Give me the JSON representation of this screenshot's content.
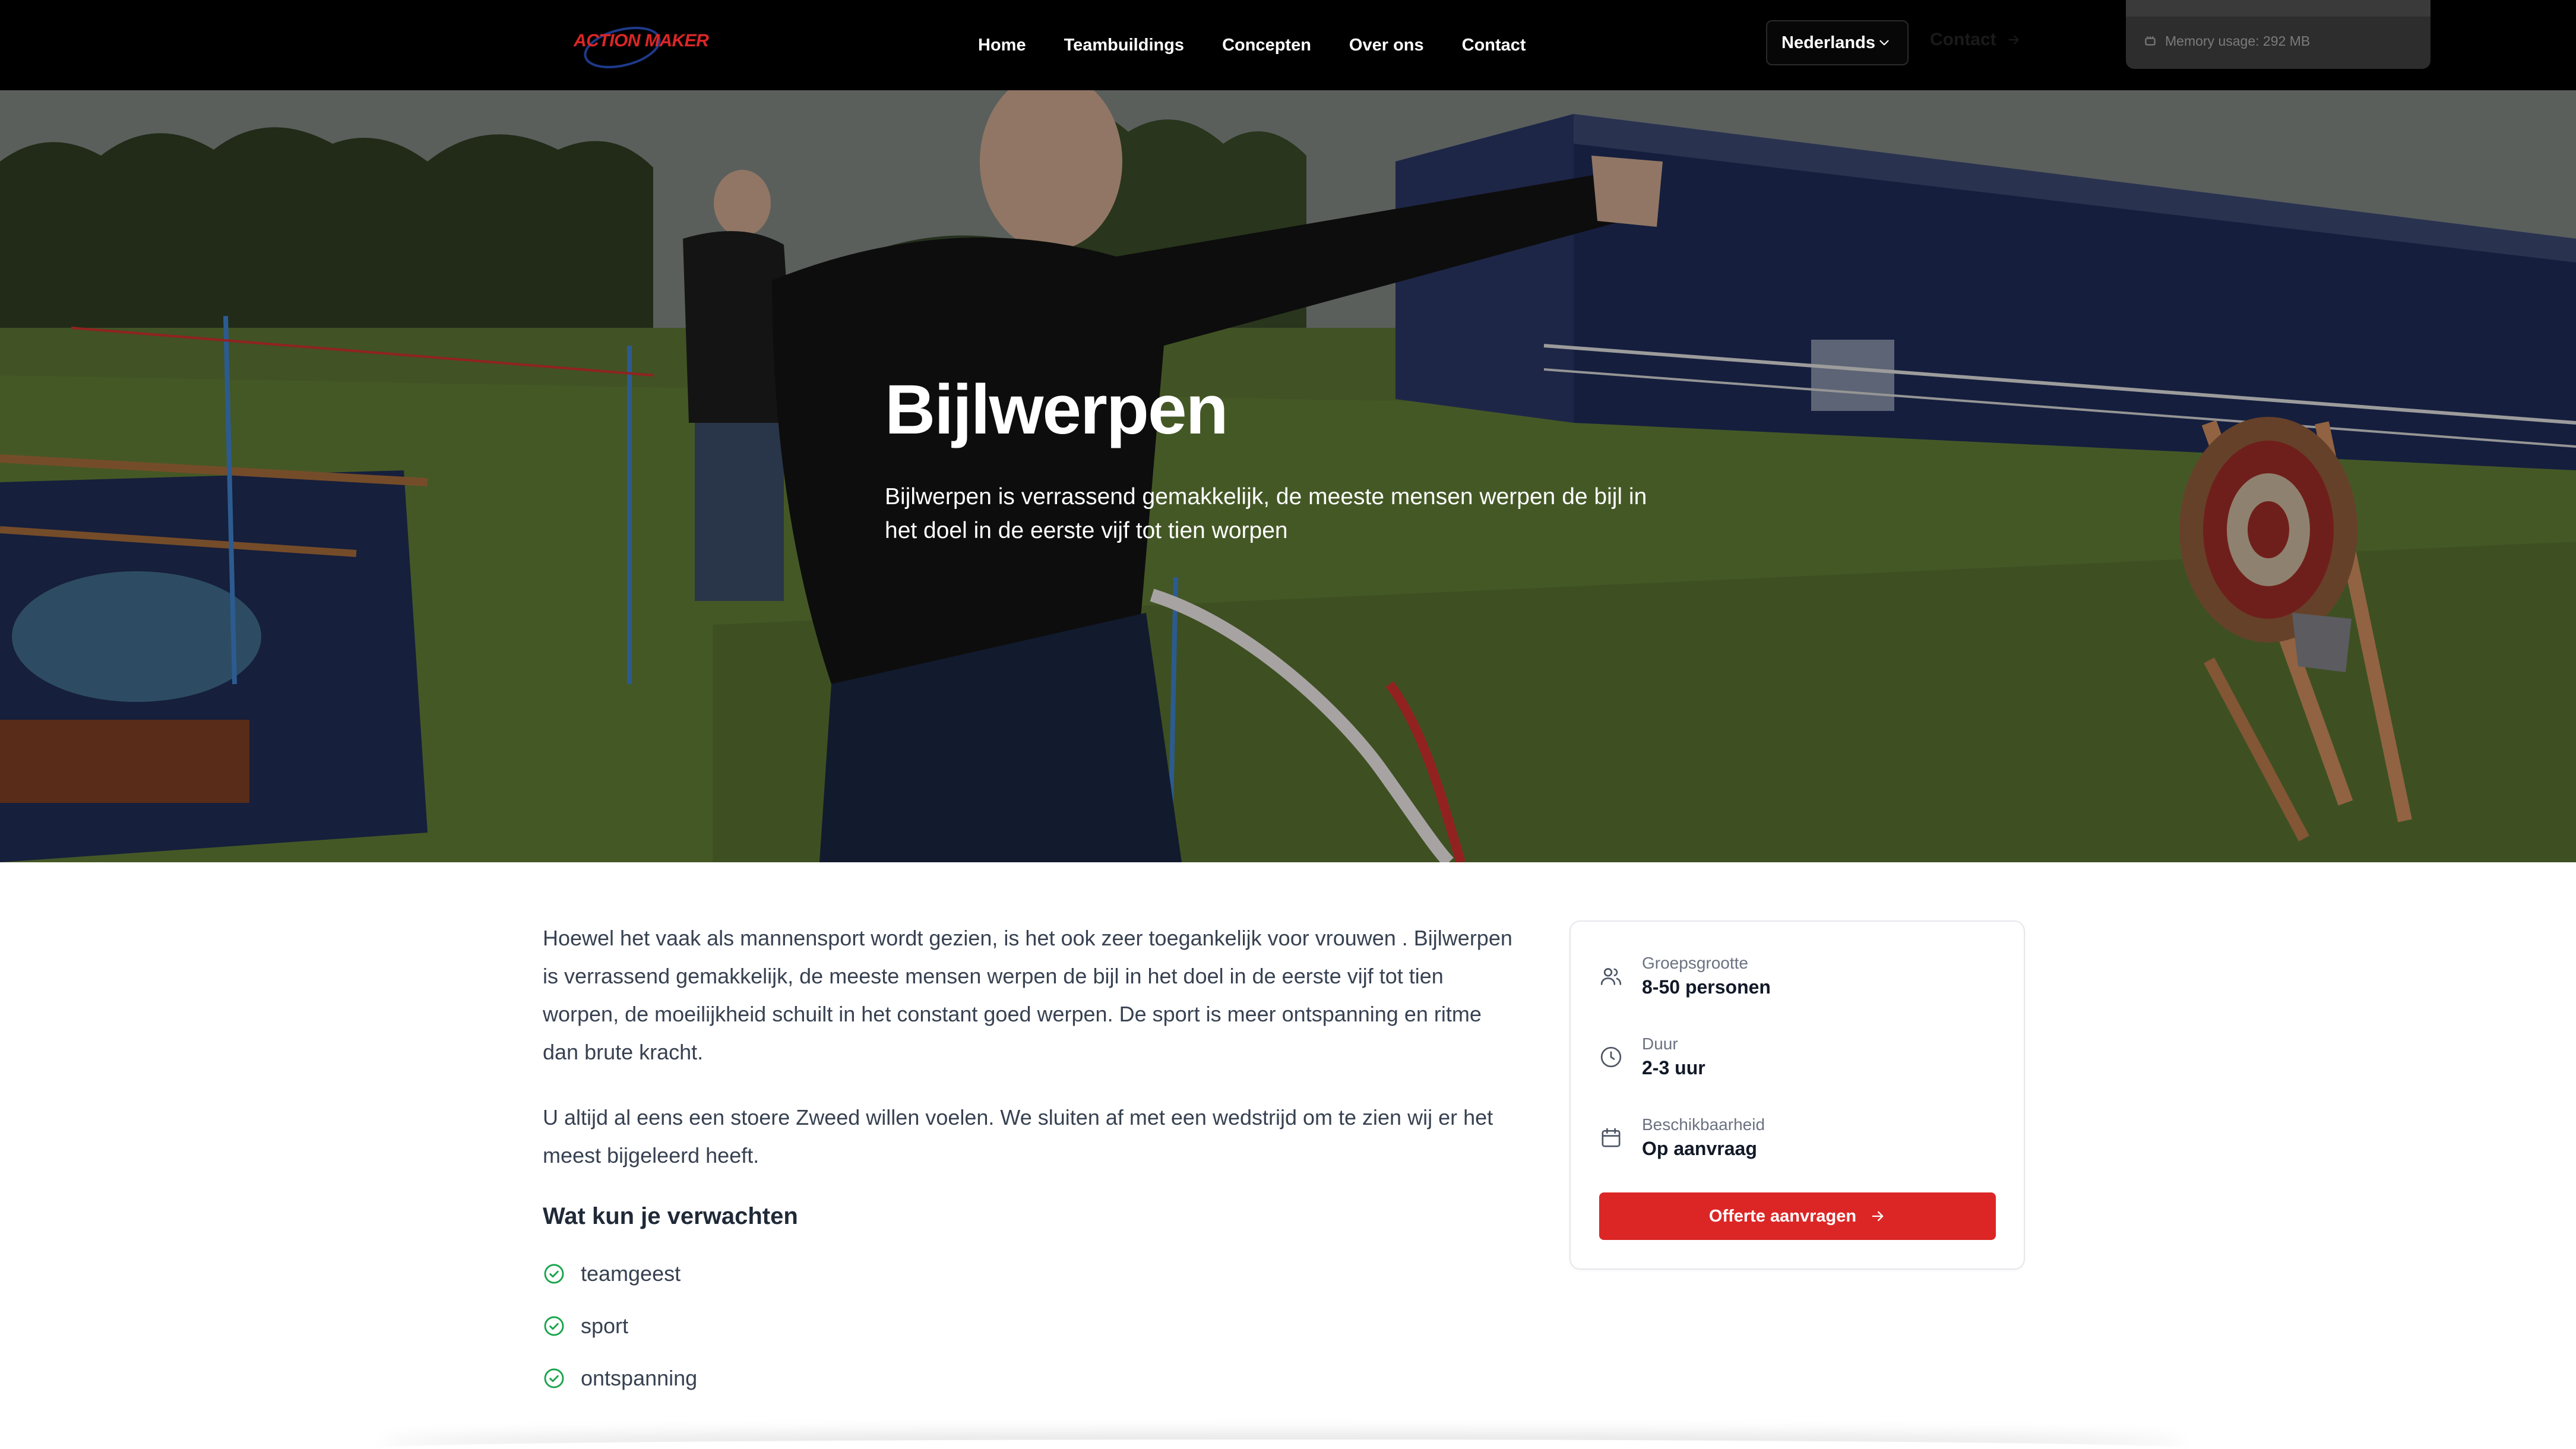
{
  "nav": {
    "logo_text": "ACTION MAKER",
    "links": [
      "Home",
      "Teambuildings",
      "Concepten",
      "Over ons",
      "Contact"
    ],
    "language": "Nederlands",
    "contact_button": "Contact",
    "memory_usage": "Memory usage: 292 MB"
  },
  "hero": {
    "title": "Bijlwerpen",
    "subtitle": "Bijlwerpen is verrassend gemakkelijk, de meeste mensen werpen de bijl in het doel in de eerste vijf tot tien worpen"
  },
  "content": {
    "paragraphs": [
      "Hoewel het vaak als mannensport wordt gezien, is het ook zeer toegankelijk voor vrouwen . Bijlwerpen is verrassend gemakkelijk, de meeste mensen werpen de bijl in het doel in de eerste vijf tot tien worpen, de moeilijkheid schuilt in het constant goed werpen. De sport is meer ontspanning en ritme dan brute kracht.",
      "U altijd al eens een stoere Zweed willen voelen. We sluiten af met een wedstrijd om te zien wij er het meest bijgeleerd heeft."
    ],
    "expect_heading": "Wat kun je verwachten",
    "expect_items": [
      "teamgeest",
      "sport",
      "ontspanning"
    ]
  },
  "sidebar": {
    "group_size": {
      "label": "Groepsgrootte",
      "value": "8-50 personen",
      "icon": "users-icon"
    },
    "duration": {
      "label": "Duur",
      "value": "2-3 uur",
      "icon": "clock-icon"
    },
    "availability": {
      "label": "Beschikbaarheid",
      "value": "Op aanvraag",
      "icon": "calendar-icon"
    },
    "cta_label": "Offerte aanvragen"
  },
  "colors": {
    "accent": "#dc2626",
    "check": "#16a34a",
    "nav_bg": "#000000"
  }
}
